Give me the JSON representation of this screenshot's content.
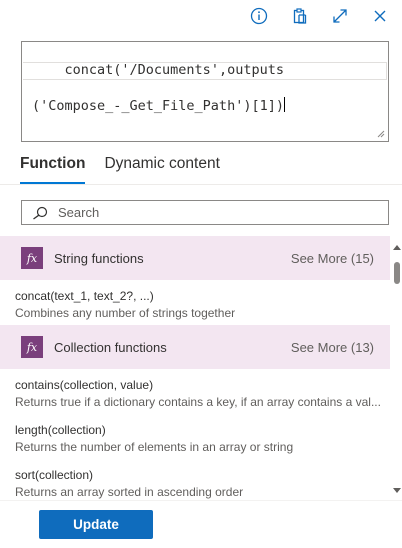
{
  "toolbar": {
    "icons": [
      "info-icon",
      "clipboard-icon",
      "expand-icon",
      "close-icon"
    ]
  },
  "expression": {
    "line1": "concat('/Documents',outputs",
    "line2": "('Compose_-_Get_File_Path')[1])"
  },
  "tabs": [
    {
      "label": "Function",
      "active": true
    },
    {
      "label": "Dynamic content",
      "active": false
    }
  ],
  "search": {
    "placeholder": "Search",
    "value": ""
  },
  "categories": [
    {
      "title": "String functions",
      "see_more": "See More (15)",
      "items": [
        {
          "signature": "concat(text_1, text_2?, ...)",
          "description": "Combines any number of strings together"
        }
      ]
    },
    {
      "title": "Collection functions",
      "see_more": "See More (13)",
      "items": [
        {
          "signature": "contains(collection, value)",
          "description": "Returns true if a dictionary contains a key, if an array contains a val..."
        },
        {
          "signature": "length(collection)",
          "description": "Returns the number of elements in an array or string"
        },
        {
          "signature": "sort(collection)",
          "description": "Returns an array sorted in ascending order"
        }
      ]
    }
  ],
  "badge_text": "fx",
  "footer": {
    "update_label": "Update"
  },
  "colors": {
    "accent": "#0078d4",
    "button": "#0f6cbd",
    "category_bg": "#f3e6f1",
    "badge": "#7a3f7c"
  }
}
